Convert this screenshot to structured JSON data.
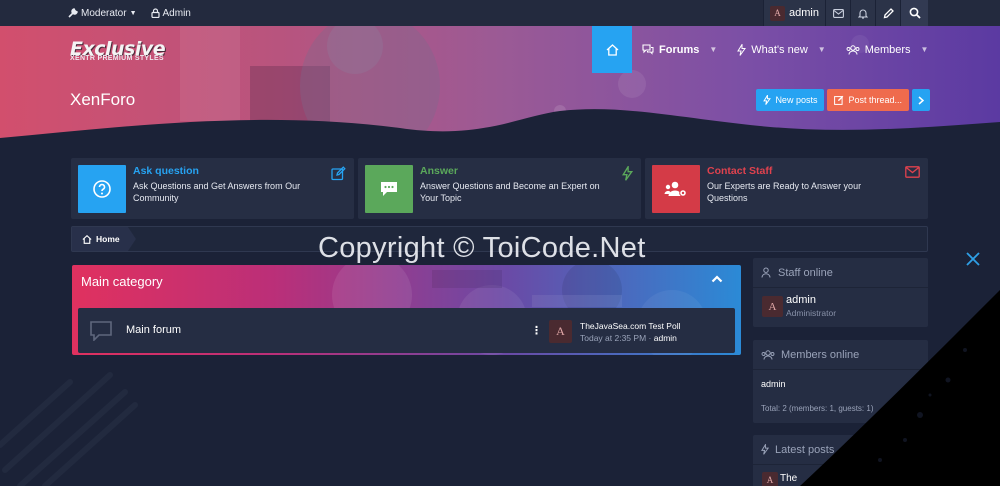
{
  "topbar": {
    "moderator": "Moderator",
    "admin": "Admin",
    "user": "admin",
    "user_avatar": "A"
  },
  "brand": {
    "logo": "Exclusive",
    "tagline": "XENTR PREMIUM STYLES",
    "site_title": "XenForo"
  },
  "nav": {
    "items": [
      {
        "label": "Forums",
        "icon": "chat-bubbles-icon"
      },
      {
        "label": "What's new",
        "icon": "bolt-icon"
      },
      {
        "label": "Members",
        "icon": "users-icon"
      }
    ]
  },
  "actions": {
    "new_posts": "New posts",
    "post_thread": "Post thread..."
  },
  "cards": [
    {
      "title": "Ask question",
      "desc": "Ask Questions and Get Answers from Our Community",
      "color": "#26a3f2",
      "icon": "question-icon",
      "action_icon": "edit-icon"
    },
    {
      "title": "Answer",
      "desc": "Answer Questions and Become an Expert on Your Topic",
      "color": "#5ba85b",
      "icon": "comment-icon",
      "action_icon": "bolt-icon"
    },
    {
      "title": "Contact Staff",
      "desc": "Our Experts are Ready to Answer your Questions",
      "color": "#d43b47",
      "icon": "users-cog-icon",
      "action_icon": "envelope-icon"
    }
  ],
  "breadcrumb": {
    "home": "Home"
  },
  "watermark": "Copyright © ToiCode.Net",
  "category": {
    "title": "Main category",
    "forum": {
      "name": "Main forum",
      "avatar": "A",
      "last_post": "TheJavaSea.com Test Poll",
      "last_time": "Today at 2:35 PM",
      "separator": "·",
      "last_user": "admin"
    }
  },
  "sidebar": {
    "staff": {
      "title": "Staff online",
      "name": "admin",
      "role": "Administrator",
      "avatar": "A"
    },
    "members": {
      "title": "Members online",
      "name": "admin",
      "total": "Total: 2 (members: 1, guests: 1)"
    },
    "latest": {
      "title": "Latest posts",
      "avatar": "A",
      "post": "The"
    }
  },
  "colors": {
    "accent": "#26a3f2",
    "new_posts_btn": "#26a3f2",
    "post_thread_btn": "#ef6b4d",
    "page_bg": "#1b2237"
  }
}
